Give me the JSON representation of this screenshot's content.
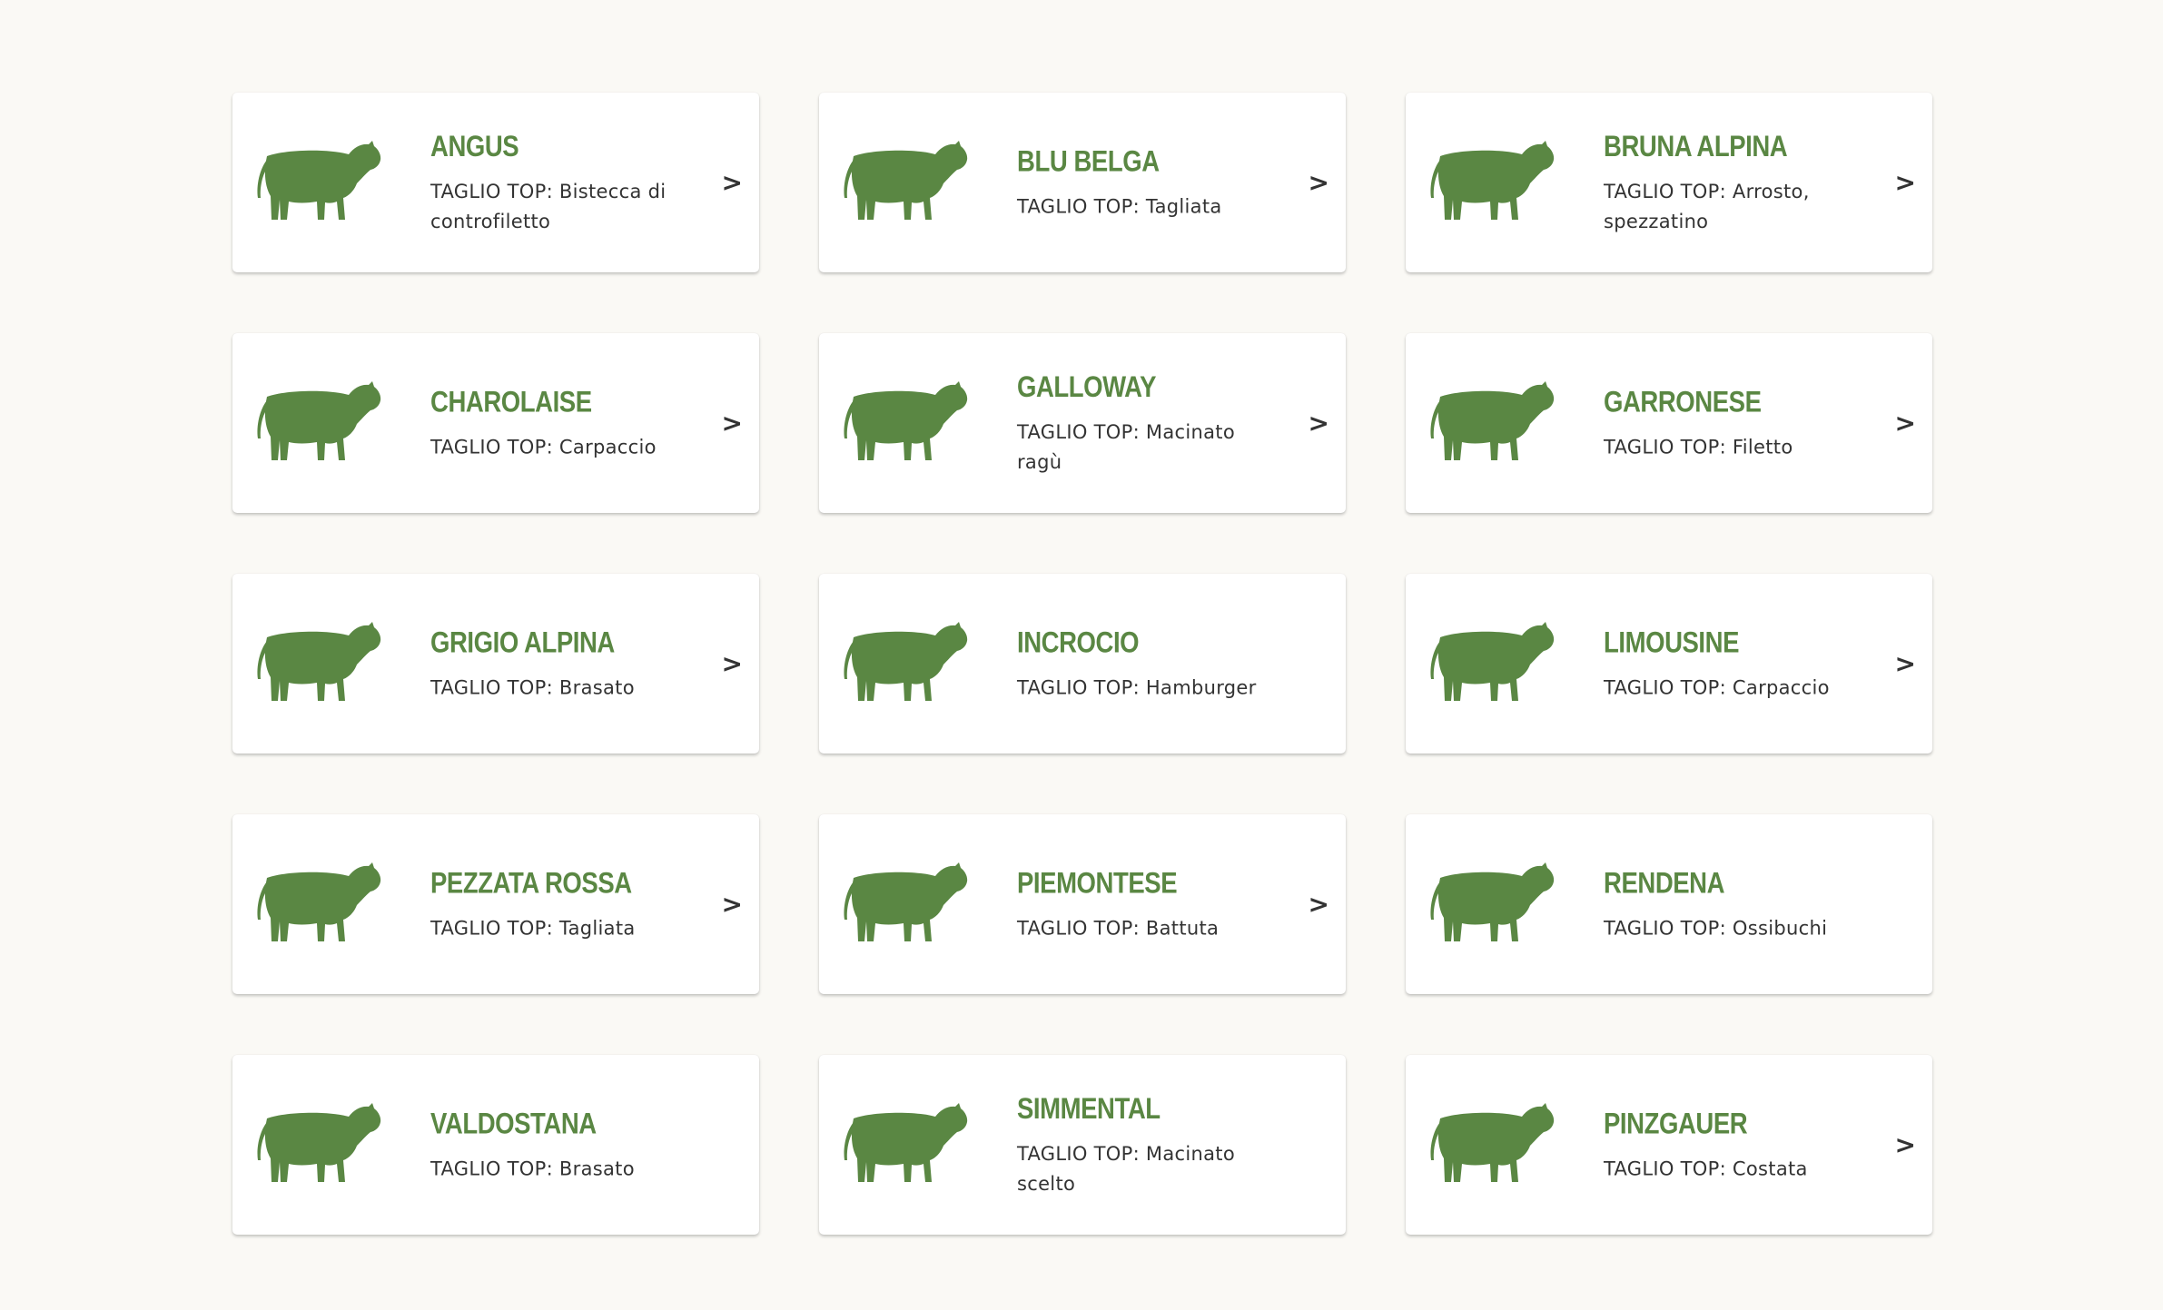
{
  "colors": {
    "page_background": "#faf9f5",
    "card_background": "#ffffff",
    "accent_green": "#5a8743",
    "text_dark": "#333333"
  },
  "cards": [
    {
      "breed": "ANGUS",
      "cut": "TAGLIO TOP: Bistecca di controfiletto",
      "arrow": ">",
      "has_arrow": true,
      "icon": "cow-icon"
    },
    {
      "breed": "BLU BELGA",
      "cut": "TAGLIO TOP: Tagliata",
      "arrow": ">",
      "has_arrow": true,
      "icon": "cow-icon"
    },
    {
      "breed": "BRUNA ALPINA",
      "cut": "TAGLIO TOP: Arrosto, spezzatino",
      "arrow": ">",
      "has_arrow": true,
      "icon": "cow-icon"
    },
    {
      "breed": "CHAROLAISE",
      "cut": "TAGLIO TOP: Carpaccio",
      "arrow": ">",
      "has_arrow": true,
      "icon": "cow-icon"
    },
    {
      "breed": "GALLOWAY",
      "cut": "TAGLIO TOP: Macinato ragù",
      "arrow": ">",
      "has_arrow": true,
      "icon": "cow-icon"
    },
    {
      "breed": "GARRONESE",
      "cut": "TAGLIO TOP: Filetto",
      "arrow": ">",
      "has_arrow": true,
      "icon": "cow-icon"
    },
    {
      "breed": "GRIGIO ALPINA",
      "cut": "TAGLIO TOP: Brasato",
      "arrow": ">",
      "has_arrow": true,
      "icon": "cow-icon"
    },
    {
      "breed": "INCROCIO",
      "cut": "TAGLIO TOP: Hamburger",
      "arrow": "",
      "has_arrow": false,
      "icon": "cow-icon"
    },
    {
      "breed": "LIMOUSINE",
      "cut": "TAGLIO TOP: Carpaccio",
      "arrow": ">",
      "has_arrow": true,
      "icon": "cow-icon"
    },
    {
      "breed": "PEZZATA ROSSA",
      "cut": "TAGLIO TOP: Tagliata",
      "arrow": ">",
      "has_arrow": true,
      "icon": "cow-icon"
    },
    {
      "breed": "PIEMONTESE",
      "cut": "TAGLIO TOP: Battuta",
      "arrow": ">",
      "has_arrow": true,
      "icon": "cow-icon"
    },
    {
      "breed": "RENDENA",
      "cut": "TAGLIO TOP: Ossibuchi",
      "arrow": "",
      "has_arrow": false,
      "icon": "cow-icon"
    },
    {
      "breed": "VALDOSTANA",
      "cut": "TAGLIO TOP: Brasato",
      "arrow": "",
      "has_arrow": false,
      "icon": "cow-icon"
    },
    {
      "breed": "SIMMENTAL",
      "cut": "TAGLIO TOP: Macinato scelto",
      "arrow": "",
      "has_arrow": false,
      "icon": "cow-icon"
    },
    {
      "breed": "PINZGAUER",
      "cut": "TAGLIO TOP: Costata",
      "arrow": ">",
      "has_arrow": true,
      "icon": "cow-icon"
    }
  ]
}
